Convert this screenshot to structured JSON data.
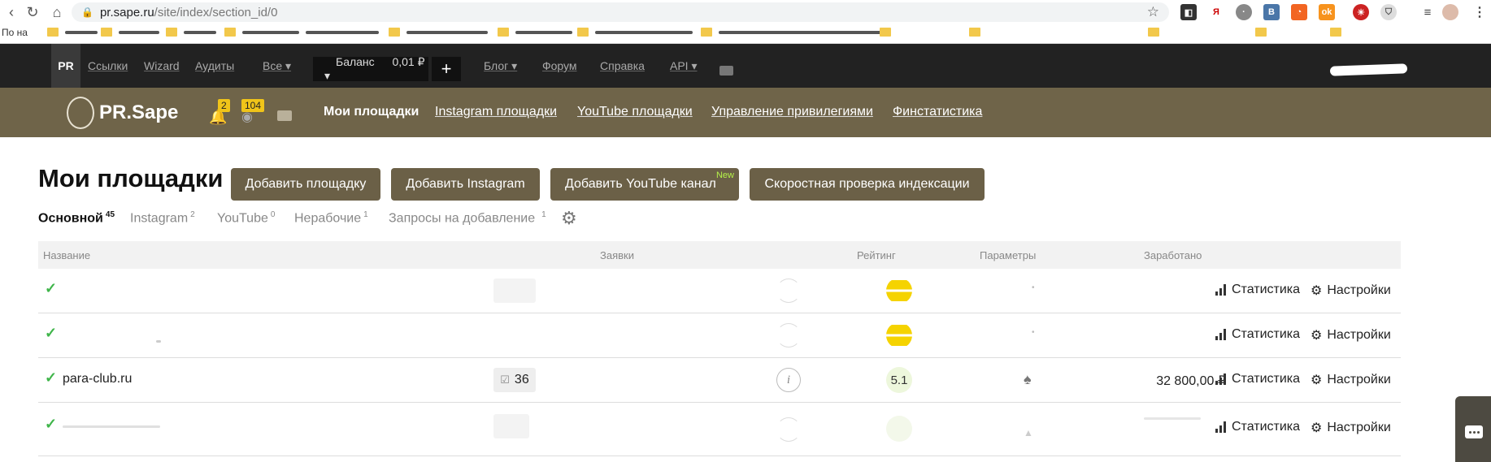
{
  "browser": {
    "url_host": "pr.sape.ru",
    "url_path": "/site/index/section_id/0",
    "bookmark_start": "По на"
  },
  "topnav": {
    "pr_badge": "PR",
    "links": [
      "Ссылки",
      "Wizard",
      "Аудиты"
    ],
    "all_dropdown": "Все",
    "balance_label": "Баланс",
    "balance_value": "0,01 ₽",
    "plus": "+",
    "blog": "Блог",
    "forum": "Форум",
    "help": "Справка",
    "api": "API"
  },
  "brand": {
    "logo_text": "PR.Sape",
    "notif_count": "2",
    "views_count": "104",
    "nav": [
      "Мои площадки",
      "Instagram площадки",
      "YouTube площадки",
      "Управление привилегиями",
      "Финстатистика"
    ]
  },
  "page": {
    "title": "Мои площадки",
    "buttons": {
      "add_site": "Добавить площадку",
      "add_instagram": "Добавить Instagram",
      "add_youtube": "Добавить YouTube канал",
      "youtube_new": "New",
      "speed_check": "Скоростная проверка индексации"
    },
    "subtabs": [
      {
        "label": "Основной",
        "count": "45"
      },
      {
        "label": "Instagram",
        "count": "2"
      },
      {
        "label": "YouTube",
        "count": "0"
      },
      {
        "label": "Нерабочие",
        "count": "1"
      },
      {
        "label": "Запросы на добавление",
        "count": "1"
      }
    ]
  },
  "table": {
    "headers": {
      "name": "Название",
      "requests": "Заявки",
      "rating": "Рейтинг",
      "params": "Параметры",
      "earned": "Заработано"
    },
    "stat_label": "Статистика",
    "settings_label": "Настройки",
    "rows": [
      {
        "site": "",
        "requests": "",
        "rating": "",
        "earned": ""
      },
      {
        "site": "",
        "requests": "",
        "rating": "",
        "earned": ""
      },
      {
        "site": "para-club.ru",
        "requests": "36",
        "rating": "5.1",
        "earned": "32 800,00 ₽",
        "info": "i"
      },
      {
        "site": "",
        "requests": "",
        "rating": "",
        "earned": ""
      }
    ]
  },
  "colors": {
    "brand_bar": "#6f6449",
    "top_nav": "#222222",
    "button": "#6b6047",
    "check": "#3fb54a",
    "rating_yellow": "#f5d300"
  }
}
